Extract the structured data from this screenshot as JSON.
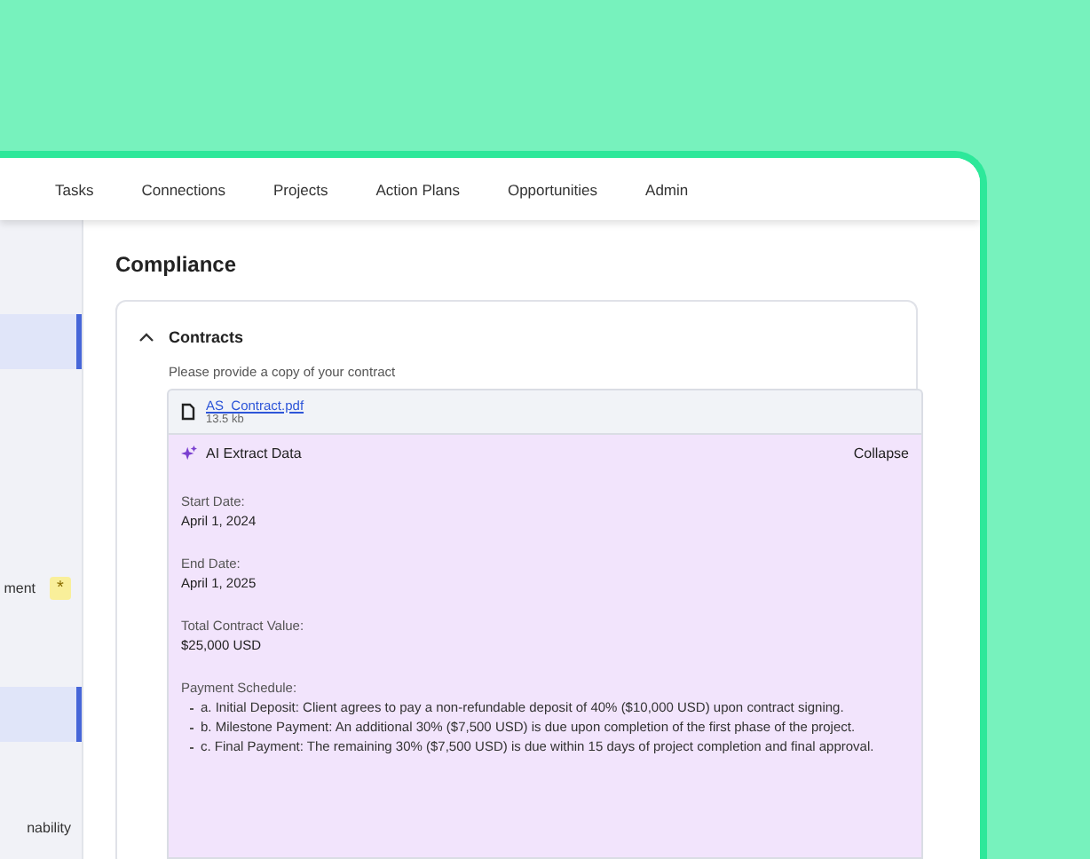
{
  "nav": {
    "items": [
      {
        "label": "Tasks",
        "selected": false
      },
      {
        "label": "Connections",
        "selected": false
      },
      {
        "label": "Projects",
        "selected": false
      },
      {
        "label": "Action Plans",
        "selected": false
      },
      {
        "label": "Opportunities",
        "selected": false
      },
      {
        "label": "Admin",
        "selected": false
      }
    ]
  },
  "sidebar": {
    "items": [
      {
        "selected": true
      },
      {
        "label": "ment",
        "badge": "*",
        "selected": false
      },
      {
        "selected": true
      },
      {
        "label": "nability",
        "selected": false
      }
    ]
  },
  "page_title": "Compliance",
  "section": {
    "title": "Contracts",
    "expanded": true,
    "prompt": "Please provide a copy of your contract",
    "file": {
      "name": "AS_Contract.pdf",
      "size": "13.5 kb"
    },
    "extract": {
      "title": "AI Extract Data",
      "toggle": "Collapse",
      "fields": [
        {
          "label": "Start Date:",
          "value": "April 1, 2024"
        },
        {
          "label": "End Date:",
          "value": "April 1, 2025"
        },
        {
          "label": "Total Contract Value:",
          "value": "$25,000 USD"
        }
      ],
      "schedule": {
        "label": "Payment Schedule:",
        "items": [
          "a. Initial Deposit: Client agrees to pay a non-refundable deposit of 40% ($10,000 USD) upon contract signing.",
          "b. Milestone Payment: An additional 30% ($7,500 USD) is due upon completion of the first phase of the project.",
          "c. Final Payment: The remaining 30% ($7,500 USD) is due within 15 days of project completion and final approval."
        ]
      }
    }
  }
}
